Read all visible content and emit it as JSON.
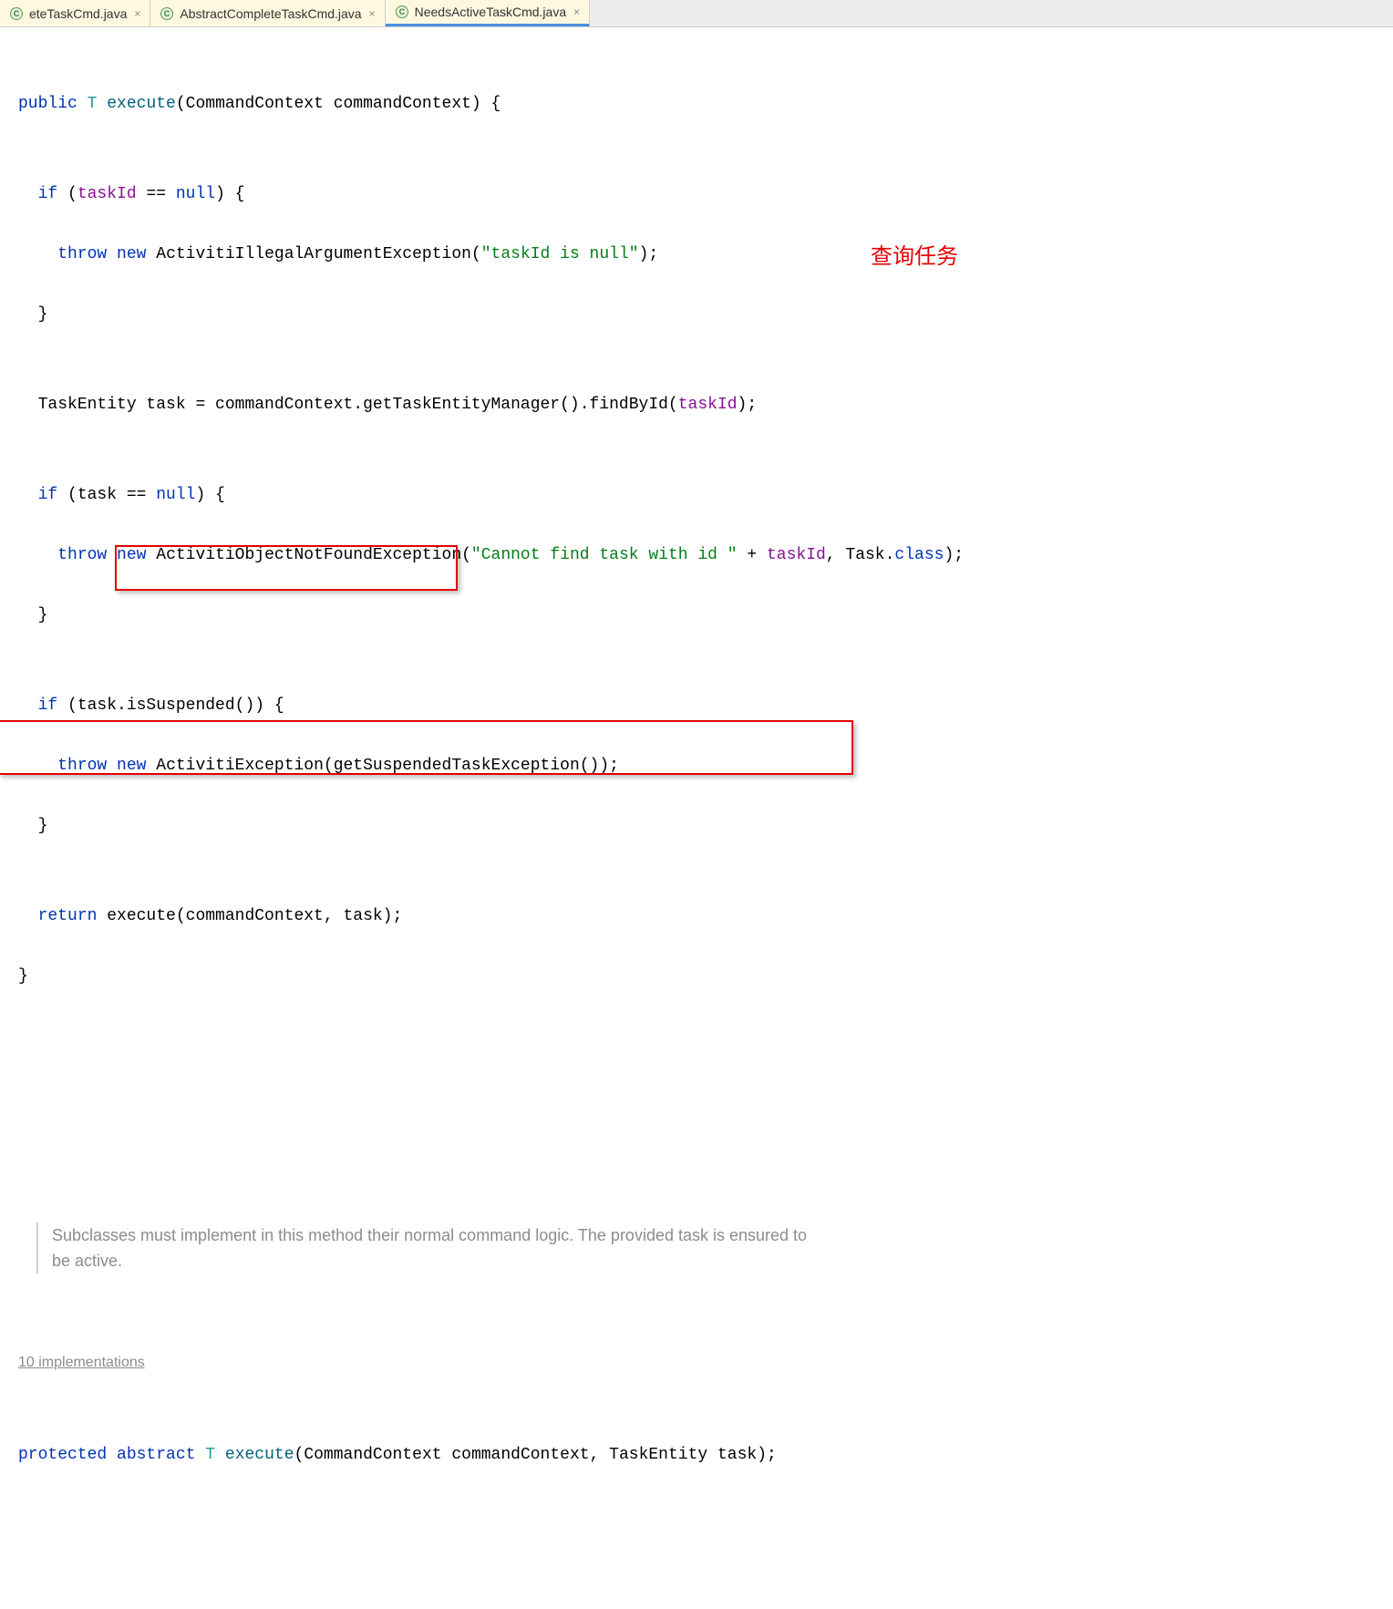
{
  "tabs": [
    {
      "label": "eteTaskCmd.java",
      "active": false,
      "highlighted": true
    },
    {
      "label": "AbstractCompleteTaskCmd.java",
      "active": false,
      "highlighted": true
    },
    {
      "label": "NeedsActiveTaskCmd.java",
      "active": true,
      "highlighted": true
    }
  ],
  "code": {
    "line1": {
      "kw_public": "public",
      "type_T": "T",
      "method": "execute",
      "params": "(CommandContext commandContext) {"
    },
    "line3": {
      "kw_if": "if",
      "open": " (",
      "field": "taskId",
      "op": " == ",
      "kw_null": "null",
      "close": ") {"
    },
    "line4": {
      "kw_throw": "throw",
      "sp1": " ",
      "kw_new": "new",
      "sp2": " ",
      "class": "ActivitiIllegalArgumentException(",
      "string": "\"taskId is null\"",
      "end": ");"
    },
    "line5": {
      "brace": "}"
    },
    "line7": {
      "prefix": "TaskEntity task = commandContext.getTaskEntityManager().findById(",
      "field": "taskId",
      "end": ");"
    },
    "line8": {
      "kw_if": "if",
      "open": " (task == ",
      "kw_null": "null",
      "close": ") {"
    },
    "line9": {
      "kw_throw": "throw",
      "sp1": " ",
      "kw_new": "new",
      "sp2": " ",
      "class": "ActivitiObjectNotFoundException(",
      "string": "\"Cannot find task with id \"",
      "plus": " + ",
      "field": "taskId",
      "mid": ", Task.",
      "kw_class": "class",
      "end": ");"
    },
    "line10": {
      "brace": "}"
    },
    "line12": {
      "kw_if": "if",
      "rest": " (task.isSuspended()) {"
    },
    "line13": {
      "kw_throw": "throw",
      "sp1": " ",
      "kw_new": "new",
      "sp2": " ",
      "class": "ActivitiException(getSuspendedTaskException());"
    },
    "line14": {
      "brace": "}"
    },
    "line16": {
      "kw_return": "return",
      "rest": " execute(commandContext, task);"
    },
    "line17": {
      "brace": "}"
    }
  },
  "annotation_query": "查询任务",
  "javadoc": "Subclasses must implement in this method their normal command logic. The provided task is ensured to be active.",
  "implementations_hint": "10 implementations",
  "abstract_method": {
    "kw_protected": "protected",
    "sp1": " ",
    "kw_abstract": "abstract",
    "sp2": " ",
    "type_T": "T",
    "sp3": " ",
    "method": "execute",
    "params": "(CommandContext commandContext, TaskEntity task);"
  }
}
